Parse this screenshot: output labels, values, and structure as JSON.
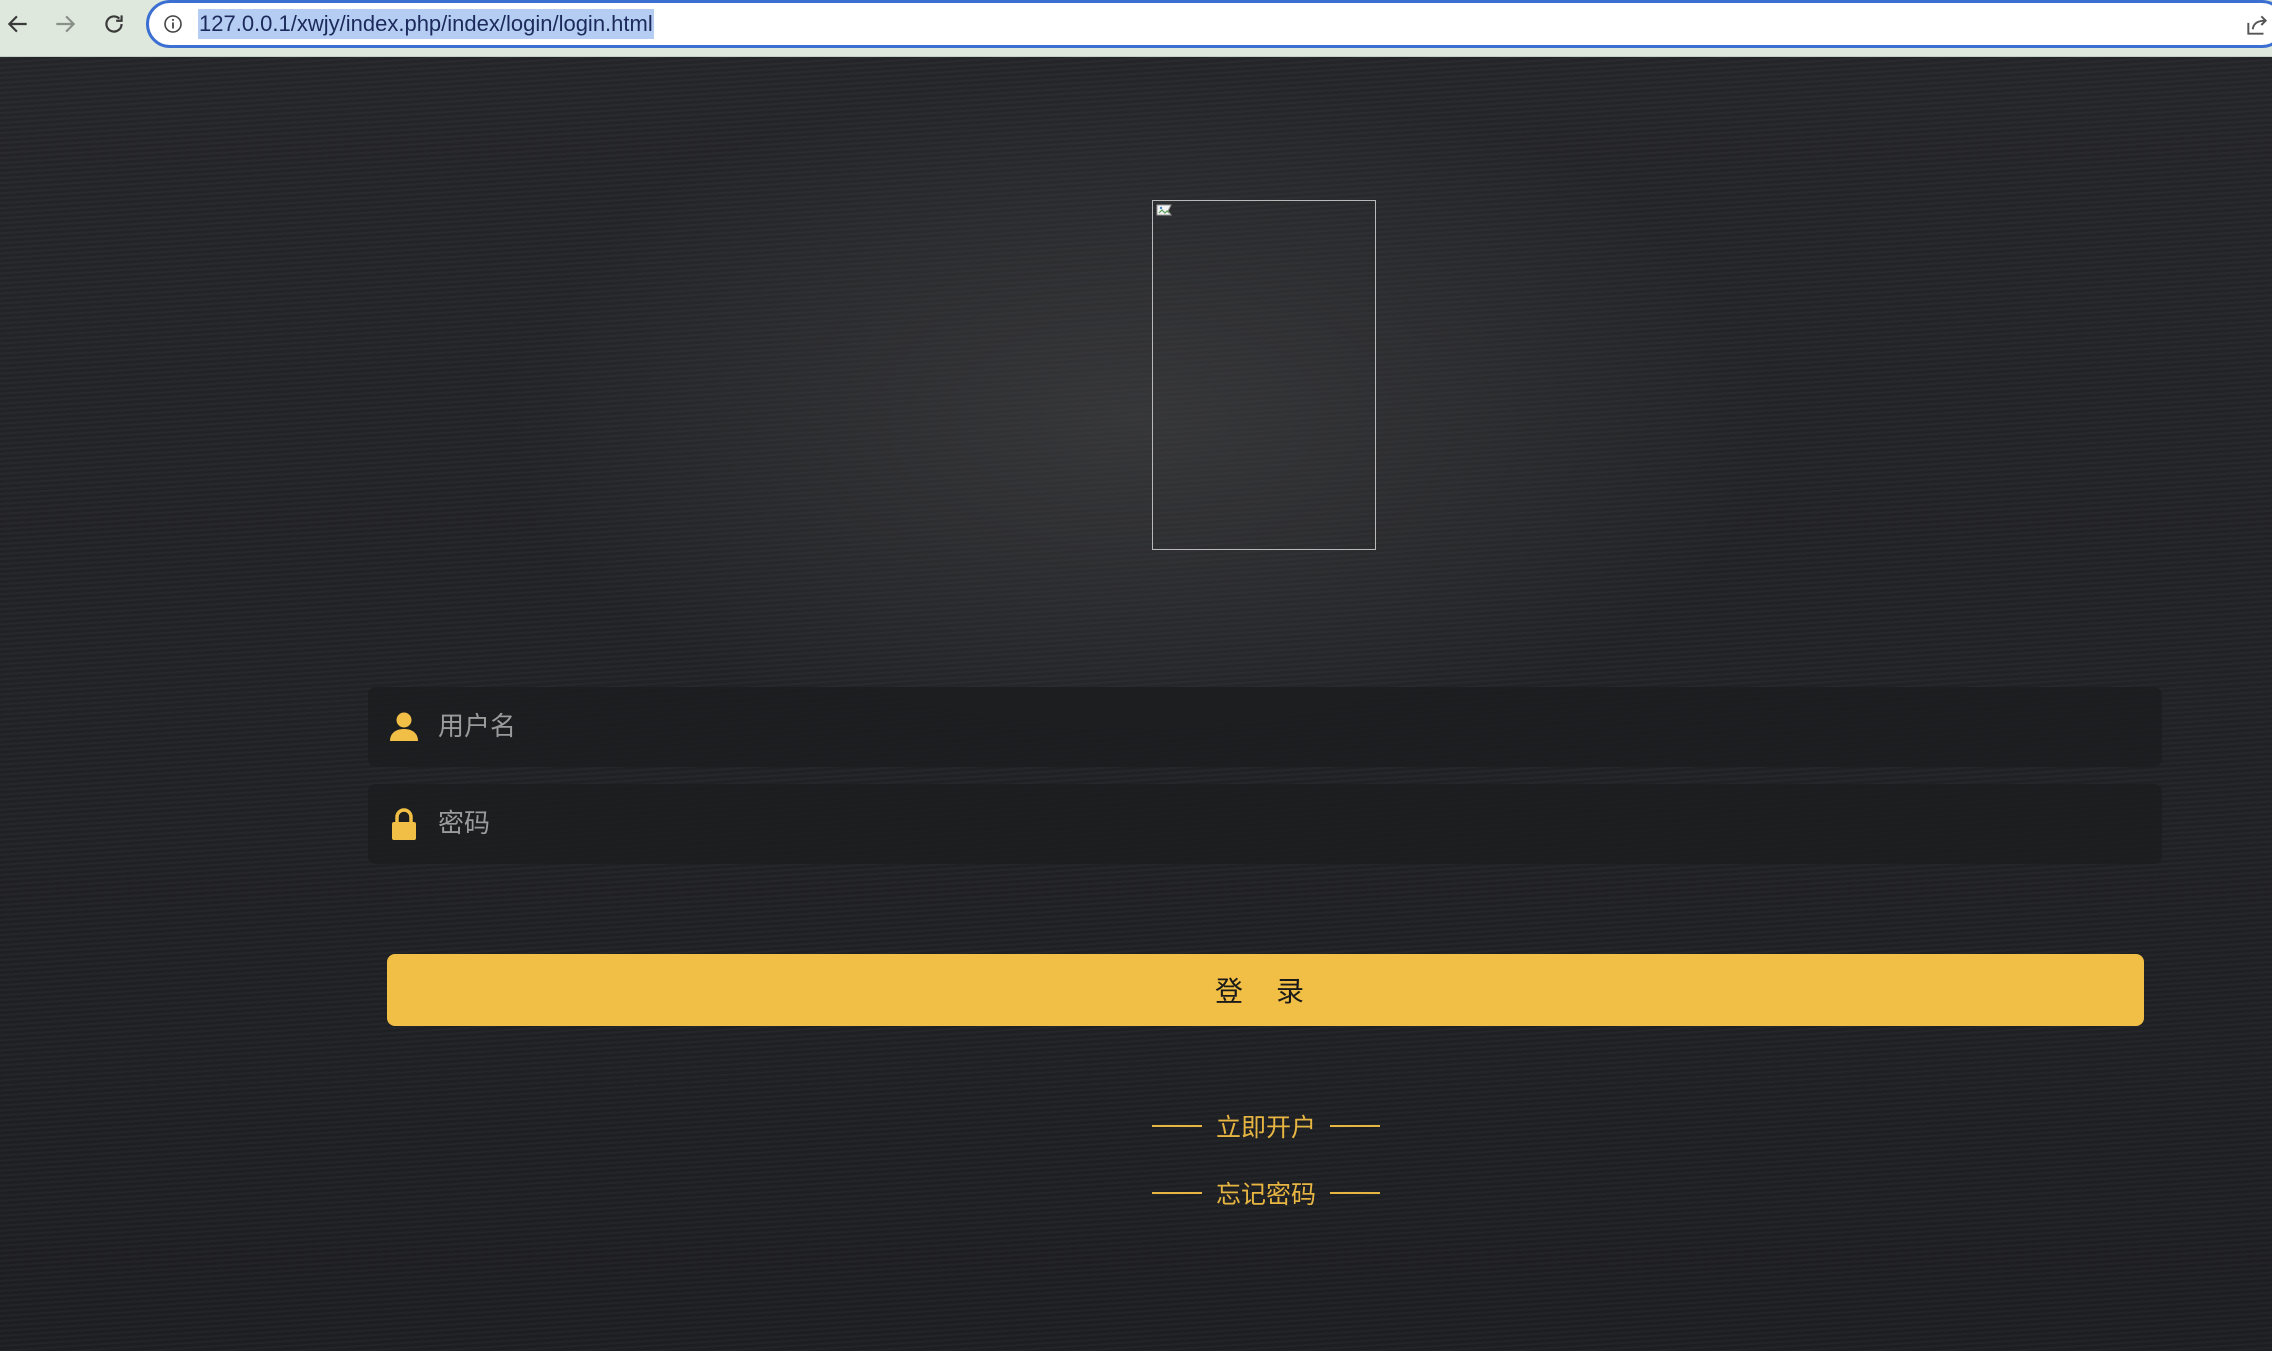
{
  "browser": {
    "url": "127.0.0.1/xwjy/index.php/index/login/login.html",
    "icons": {
      "back": "arrow-left-icon",
      "forward": "arrow-right-icon",
      "reload": "reload-icon",
      "site_info": "info-icon",
      "share": "share-icon"
    }
  },
  "login": {
    "logo_icon": "broken-image-icon",
    "username_placeholder": "用户名",
    "password_placeholder": "密码",
    "username_icon": "user-icon",
    "password_icon": "lock-icon",
    "submit_label": "登 录",
    "register_link": "立即开户",
    "forgot_link": "忘记密码"
  },
  "colors": {
    "accent": "#f2bf46",
    "link": "#e7b542",
    "background": "#1f2023",
    "address_border": "#3b6fd1"
  }
}
